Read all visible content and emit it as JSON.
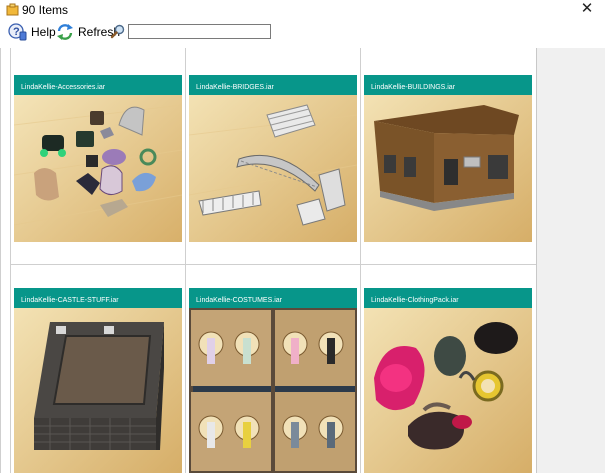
{
  "window": {
    "title": "90 Items",
    "close_glyph": "✕"
  },
  "toolbar": {
    "help_label": "Help",
    "refresh_label": "Refresh",
    "search_value": "",
    "search_placeholder": ""
  },
  "items": [
    {
      "label": "LindaKellie-Accessories.iar",
      "icon": "accessories-thumbnail"
    },
    {
      "label": "LindaKellie-BRIDGES.iar",
      "icon": "bridges-thumbnail"
    },
    {
      "label": "LindaKellie-BUILDINGS.iar",
      "icon": "buildings-thumbnail"
    },
    {
      "label": "LindaKellie-CASTLE-STUFF.iar",
      "icon": "castle-thumbnail"
    },
    {
      "label": "LindaKellie-COSTUMES.iar",
      "icon": "costumes-thumbnail"
    },
    {
      "label": "LindaKellie-ClothingPack.iar",
      "icon": "clothing-thumbnail"
    }
  ],
  "colors": {
    "header_teal": "#07968a",
    "floor_light": "#f2dfae",
    "floor_dark": "#d9b774"
  }
}
